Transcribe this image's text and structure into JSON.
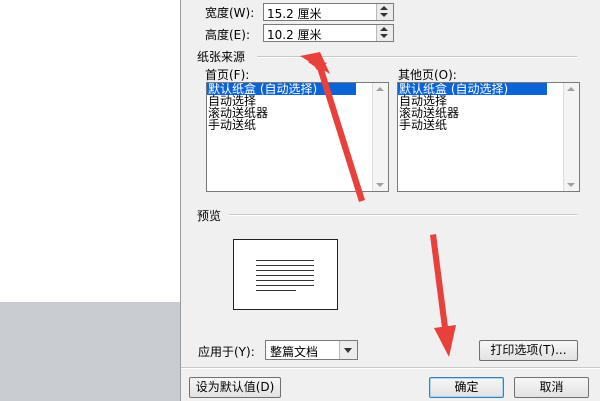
{
  "dialog": {
    "size": {
      "width_label": "宽度(W):",
      "width_value": "15.2 厘米",
      "height_label": "高度(E):",
      "height_value": "10.2 厘米"
    },
    "paper_source": {
      "title": "纸张来源",
      "first_page_label": "首页(F):",
      "other_pages_label": "其他页(O):",
      "options": [
        "默认纸盒 (自动选择)",
        "自动选择",
        "滚动送纸器",
        "手动送纸"
      ],
      "first_page_selected": "默认纸盒 (自动选择)",
      "other_pages_selected": "默认纸盒 (自动选择)"
    },
    "preview": {
      "title": "预览"
    },
    "apply_to": {
      "label": "应用于(Y):",
      "value": "整篇文档"
    },
    "buttons": {
      "print_options": "打印选项(T)...",
      "set_default": "设为默认值(D)",
      "ok": "确定",
      "cancel": "取消"
    }
  },
  "colors": {
    "dialog_bg": "#f0f0f0",
    "selection": "#0a64d6",
    "annotation_arrow": "#e8403a"
  }
}
